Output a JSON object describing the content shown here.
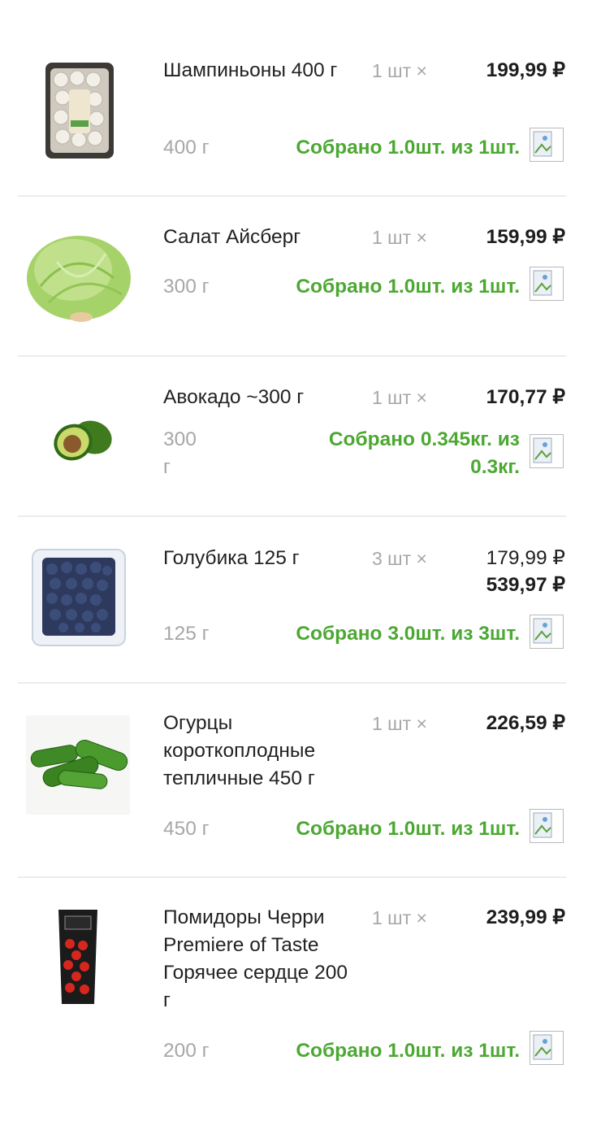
{
  "items": [
    {
      "name": "Шампиньоны 400 г",
      "qty": "1 шт ×",
      "price": "199,99 ₽",
      "weight": "400 г",
      "status": "Собрано 1.0шт. из 1шт.",
      "image": "mushrooms-tray-image"
    },
    {
      "name": "Салат Айсберг",
      "qty": "1 шт ×",
      "price": "159,99 ₽",
      "weight": "300 г",
      "status": "Собрано 1.0шт. из 1шт.",
      "image": "iceberg-lettuce-image"
    },
    {
      "name": "Авокадо ~300 г",
      "qty": "1 шт ×",
      "price": "170,77 ₽",
      "weight": "300 г",
      "status": "Собрано 0.345кг. из 0.3кг.",
      "image": "avocado-image"
    },
    {
      "name": "Голубика 125 г",
      "qty": "3 шт ×",
      "unit_price": "179,99 ₽",
      "price": "539,97 ₽",
      "weight": "125 г",
      "status": "Собрано 3.0шт. из 3шт.",
      "image": "blueberry-box-image"
    },
    {
      "name": "Огурцы короткоплодные тепличные 450 г",
      "qty": "1 шт ×",
      "price": "226,59 ₽",
      "weight": "450 г",
      "status": "Собрано 1.0шт. из 1шт.",
      "image": "cucumbers-image"
    },
    {
      "name": "Помидоры Черри Premiere of Taste Горячее сердце 200 г",
      "qty": "1 шт ×",
      "price": "239,99 ₽",
      "weight": "200 г",
      "status": "Собрано 1.0шт. из 1шт.",
      "image": "cherry-tomatoes-pack-image"
    }
  ],
  "icons": {
    "broken_image": "broken-image-icon"
  },
  "colors": {
    "status_green": "#4ca832",
    "muted_gray": "#a7a7a7",
    "text": "#222222"
  }
}
